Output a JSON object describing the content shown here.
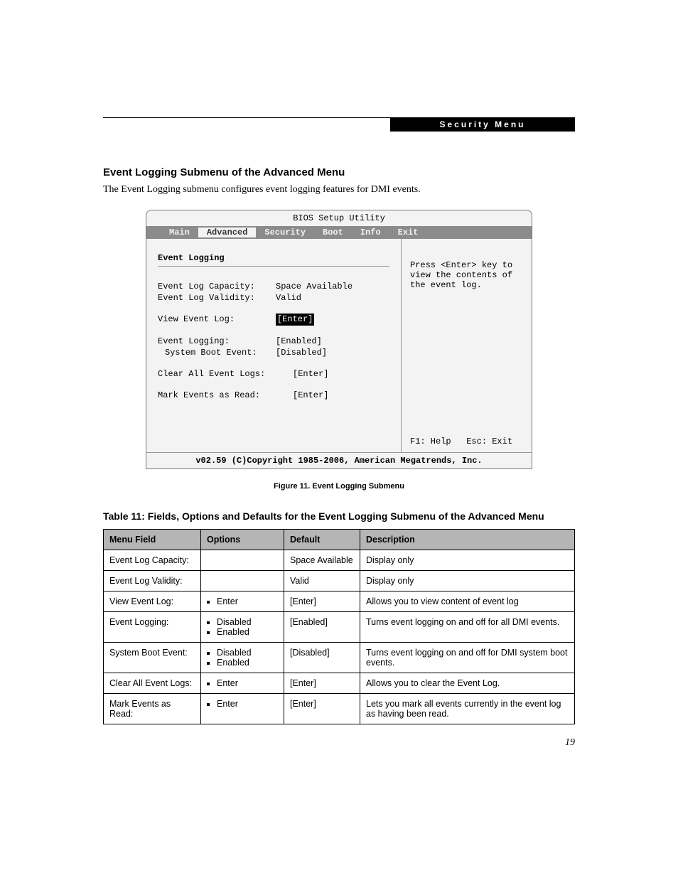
{
  "header": {
    "tag": "Security Menu"
  },
  "section": {
    "title": "Event Logging Submenu of the Advanced Menu",
    "intro": "The Event Logging submenu configures event logging features for DMI events."
  },
  "bios": {
    "title": "BIOS Setup Utility",
    "tabs": [
      "Main",
      "Advanced",
      "Security",
      "Boot",
      "Info",
      "Exit"
    ],
    "active_tab_index": 1,
    "panel_title": "Event Logging",
    "rows": {
      "capacity_label": "Event Log Capacity:",
      "capacity_value": "Space Available",
      "validity_label": "Event Log Validity:",
      "validity_value": "Valid",
      "view_label": "View Event Log:",
      "view_value": "[Enter]",
      "logging_label": "Event Logging:",
      "logging_value": "[Enabled]",
      "sysboot_label": "System Boot Event:",
      "sysboot_value": "[Disabled]",
      "clear_label": "Clear All Event Logs:",
      "clear_value": "[Enter]",
      "mark_label": "Mark Events as Read:",
      "mark_value": "[Enter]"
    },
    "help": {
      "l1": "Press <Enter> key to",
      "l2": "view the contents of",
      "l3": "the event log."
    },
    "keys": "F1: Help   Esc: Exit",
    "copyright": "v02.59 (C)Copyright 1985-2006, American Megatrends, Inc."
  },
  "figure_caption": "Figure 11.   Event Logging Submenu",
  "table_title": "Table 11: Fields, Options and Defaults for the Event Logging Submenu of the Advanced Menu",
  "table": {
    "headers": [
      "Menu Field",
      "Options",
      "Default",
      "Description"
    ],
    "rows": [
      {
        "field": "Event Log Capacity:",
        "indent": false,
        "options": [],
        "default": "Space Available",
        "desc": "Display only"
      },
      {
        "field": "Event Log Validity:",
        "indent": false,
        "options": [],
        "default": "Valid",
        "desc": "Display only"
      },
      {
        "field": "View Event Log:",
        "indent": false,
        "options": [
          "Enter"
        ],
        "default": "[Enter]",
        "desc": "Allows you to view content of event log"
      },
      {
        "field": "Event Logging:",
        "indent": false,
        "options": [
          "Disabled",
          "Enabled"
        ],
        "default": "[Enabled]",
        "desc": "Turns event logging on and off for all DMI events."
      },
      {
        "field": "System Boot Event:",
        "indent": true,
        "options": [
          "Disabled",
          "Enabled"
        ],
        "default": "[Disabled]",
        "desc": "Turns event logging on and off for DMI system boot events."
      },
      {
        "field": "Clear All Event Logs:",
        "indent": false,
        "options": [
          "Enter"
        ],
        "default": "[Enter]",
        "desc": "Allows you to clear the Event Log."
      },
      {
        "field": "Mark Events as Read:",
        "indent": false,
        "options": [
          "Enter"
        ],
        "default": "[Enter]",
        "desc": "Lets you mark all events currently in the event log as having been read."
      }
    ]
  },
  "page_number": "19"
}
